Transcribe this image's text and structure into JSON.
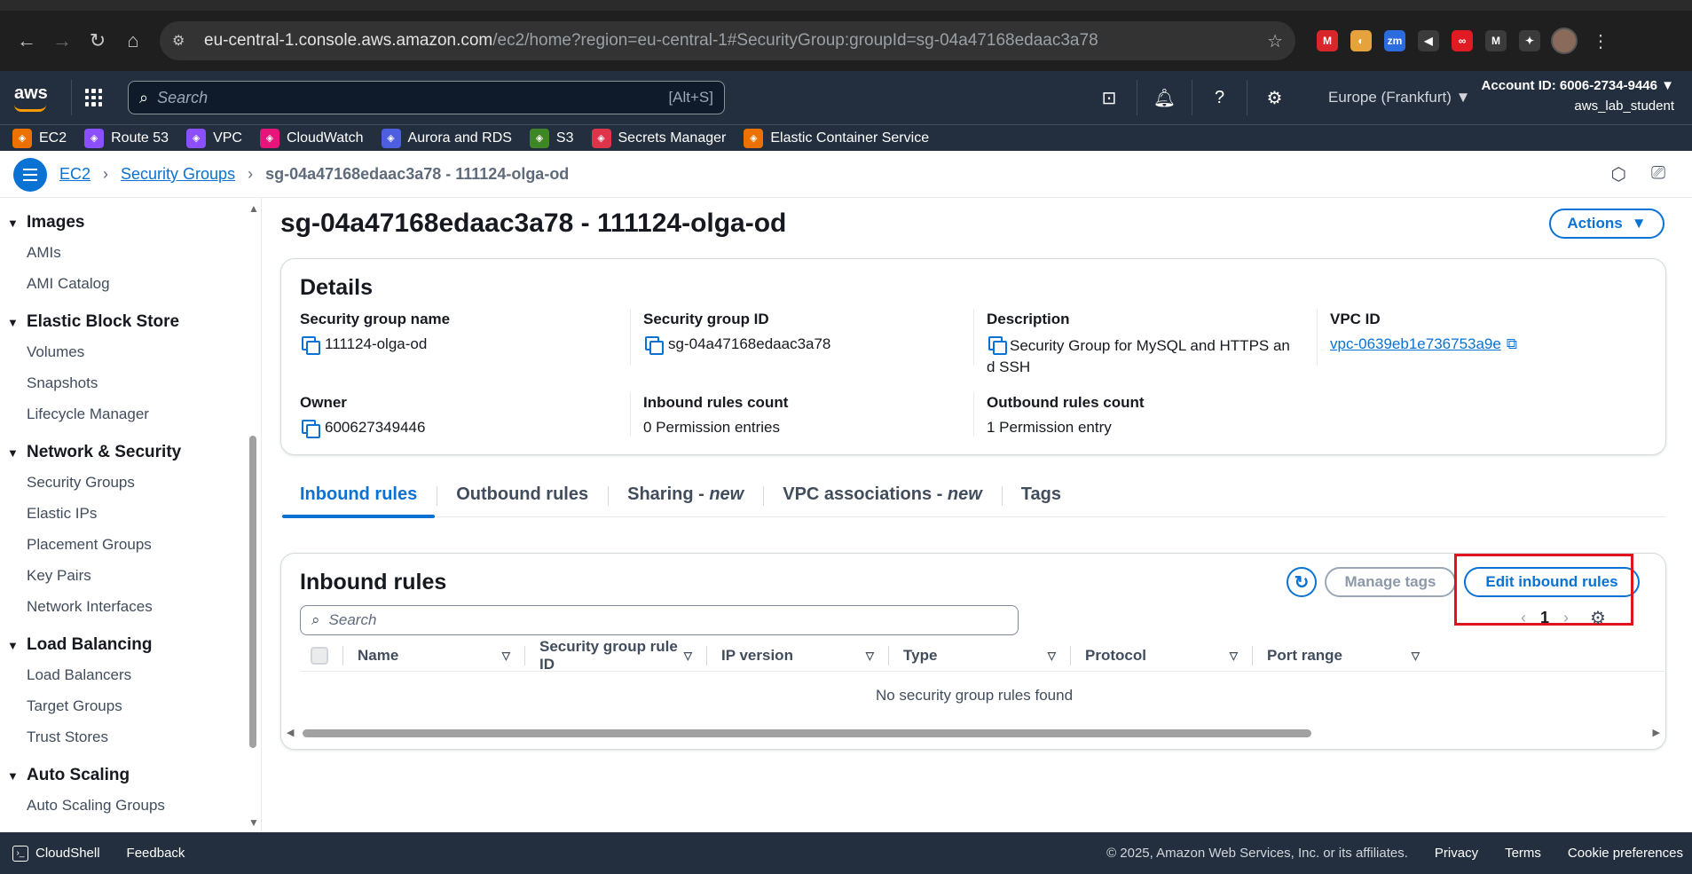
{
  "browser": {
    "url_host": "eu-central-1.console.aws.amazon.com",
    "url_path": "/ec2/home?region=eu-central-1#SecurityGroup:groupId=sg-04a47168edaac3a78",
    "extensions": [
      {
        "name": "mendeley-icon",
        "color": "#d9262a",
        "glyph": "M"
      },
      {
        "name": "color-picker-icon",
        "color": "#e6a23c",
        "glyph": "◐"
      },
      {
        "name": "zoom-icon",
        "color": "#2d6cdf",
        "glyph": "zm"
      },
      {
        "name": "megaphone-icon",
        "color": "#3b3b3b",
        "glyph": "◀"
      },
      {
        "name": "infinity-icon",
        "color": "#e01b24",
        "glyph": "∞"
      },
      {
        "name": "italic-m-icon",
        "color": "#3b3b3b",
        "glyph": "M"
      },
      {
        "name": "puzzle-icon",
        "color": "#3b3b3b",
        "glyph": "✦"
      }
    ]
  },
  "awsnav": {
    "logo": "aws",
    "search_placeholder": "Search",
    "search_shortcut": "[Alt+S]",
    "region": "Europe (Frankfurt) ▼",
    "account_id": "Account ID: 6006-2734-9446 ▼",
    "username": "aws_lab_student"
  },
  "favorites": [
    {
      "label": "EC2",
      "color": "#ed7100",
      "icon": "ec2-icon"
    },
    {
      "label": "Route 53",
      "color": "#8c4fff",
      "icon": "route53-icon"
    },
    {
      "label": "VPC",
      "color": "#8c4fff",
      "icon": "vpc-icon"
    },
    {
      "label": "CloudWatch",
      "color": "#e7157b",
      "icon": "cloudwatch-icon"
    },
    {
      "label": "Aurora and RDS",
      "color": "#4d5fe0",
      "icon": "rds-icon"
    },
    {
      "label": "S3",
      "color": "#3f8624",
      "icon": "s3-icon"
    },
    {
      "label": "Secrets Manager",
      "color": "#dd344c",
      "icon": "secrets-manager-icon"
    },
    {
      "label": "Elastic Container Service",
      "color": "#ed7100",
      "icon": "ecs-icon"
    }
  ],
  "breadcrumb": {
    "ec2": "EC2",
    "security_groups": "Security Groups",
    "current": "sg-04a47168edaac3a78 - 111124-olga-od"
  },
  "sidebar": [
    {
      "heading": "Images",
      "items": [
        "AMIs",
        "AMI Catalog"
      ]
    },
    {
      "heading": "Elastic Block Store",
      "items": [
        "Volumes",
        "Snapshots",
        "Lifecycle Manager"
      ]
    },
    {
      "heading": "Network & Security",
      "items": [
        "Security Groups",
        "Elastic IPs",
        "Placement Groups",
        "Key Pairs",
        "Network Interfaces"
      ]
    },
    {
      "heading": "Load Balancing",
      "items": [
        "Load Balancers",
        "Target Groups",
        "Trust Stores"
      ]
    },
    {
      "heading": "Auto Scaling",
      "items": [
        "Auto Scaling Groups"
      ]
    }
  ],
  "page": {
    "title": "sg-04a47168edaac3a78 - 111124-olga-od",
    "actions": "Actions"
  },
  "details": {
    "heading": "Details",
    "sg_name_label": "Security group name",
    "sg_name": "111124-olga-od",
    "sg_id_label": "Security group ID",
    "sg_id": "sg-04a47168edaac3a78",
    "description_label": "Description",
    "description": "Security Group for MySQL and HTTPS and SSH",
    "vpc_label": "VPC ID",
    "vpc_id": "vpc-0639eb1e736753a9e",
    "owner_label": "Owner",
    "owner": "600627349446",
    "inbound_count_label": "Inbound rules count",
    "inbound_count": "0 Permission entries",
    "outbound_count_label": "Outbound rules count",
    "outbound_count": "1 Permission entry"
  },
  "tabs": [
    {
      "label": "Inbound rules",
      "suffix": ""
    },
    {
      "label": "Outbound rules",
      "suffix": ""
    },
    {
      "label": "Sharing - ",
      "suffix": "new"
    },
    {
      "label": "VPC associations - ",
      "suffix": "new"
    },
    {
      "label": "Tags",
      "suffix": ""
    }
  ],
  "rules": {
    "heading": "Inbound rules",
    "manage_tags": "Manage tags",
    "edit": "Edit inbound rules",
    "search_placeholder": "Search",
    "page_number": "1",
    "columns": [
      "Name",
      "Security group rule ID",
      "IP version",
      "Type",
      "Protocol",
      "Port range"
    ],
    "empty": "No security group rules found"
  },
  "footer": {
    "cloudshell": "CloudShell",
    "feedback": "Feedback",
    "copyright": "© 2025, Amazon Web Services, Inc. or its affiliates.",
    "privacy": "Privacy",
    "terms": "Terms",
    "cookies": "Cookie preferences"
  }
}
